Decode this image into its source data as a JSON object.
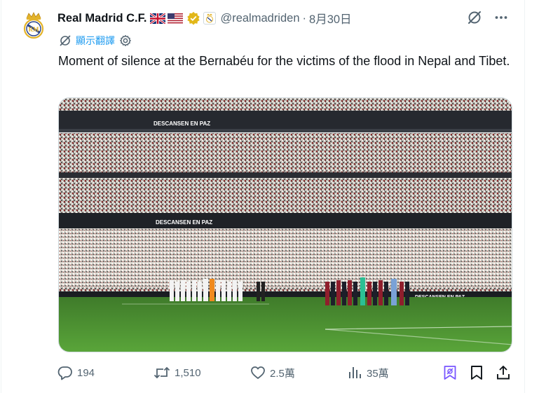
{
  "tweet": {
    "author_name": "Real Madrid C.F.",
    "handle": "@realmadriden",
    "separator": "·",
    "date": "8月30日",
    "translate_label": "顯示翻譯",
    "text": "Moment of silence at the Bernabéu for the victims of the flood in Nepal and Tibet.",
    "media": {
      "banner_upper": "DESCANSEN EN PAZ",
      "banner_lower": "DESCANSEN EN PAZ",
      "banner_pitch": "DESCANSEN EN PAZ"
    },
    "stats": {
      "replies": "194",
      "reposts": "1,510",
      "likes": "2.5萬",
      "views": "35萬"
    }
  },
  "colors": {
    "accent_blue": "#1d9bf0",
    "secondary_text": "#536471",
    "grok_purple": "#7856ff",
    "verified_gold": "#e2b719"
  },
  "icons": [
    "real-madrid-crest-icon",
    "uk-flag-icon",
    "us-flag-icon",
    "verified-badge-icon",
    "affiliate-badge-icon",
    "grok-icon",
    "more-icon",
    "translate-icon",
    "settings-icon",
    "reply-icon",
    "repost-icon",
    "like-icon",
    "views-icon",
    "grok-bookmark-icon",
    "bookmark-icon",
    "share-icon"
  ]
}
